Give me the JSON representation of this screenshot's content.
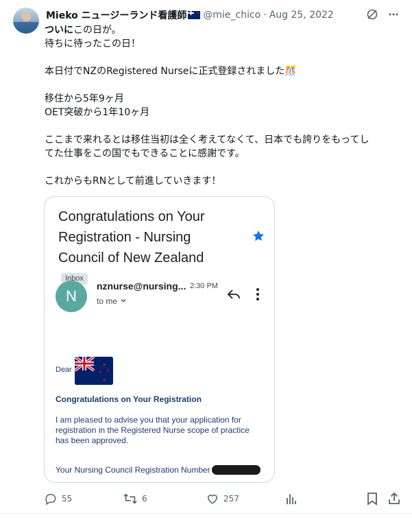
{
  "author": {
    "name": "Mieko ニュージーランド看護師",
    "handle": "@mie_chico",
    "separator": "·",
    "date": "Aug 25, 2022"
  },
  "tweet": {
    "line1_bold": "ついに",
    "line1_rest": "この日が。",
    "line2": "待ちに待ったこの日！",
    "line3": "本日付でNZのRegistered Nurseに正式登録されました🎊",
    "line4": "移住から5年9ヶ月",
    "line5": "OET突破から1年10ヶ月",
    "line6": "ここまで来れるとは移住当初は全く考えてなくて、日本でも誇りをもってし",
    "line7": "てた仕事をこの国でもできることに感謝です。",
    "line8": "これからもRNとして前進していきます！"
  },
  "email": {
    "subject": "Congratulations on Your Registration - Nursing Council of New Zealand",
    "label": "Inbox",
    "sender_initial": "N",
    "sender": "nznurse@nursing...",
    "time": "2:30 PM",
    "to": "to me",
    "greeting": "Dear",
    "heading": "Congratulations on Your Registration",
    "body": "I am pleased to advise you that your application for registration in the Registered Nurse scope of practice has been approved.",
    "reg_label": "Your Nursing Council Registration Number"
  },
  "actions": {
    "replies": "55",
    "retweets": "6",
    "likes": "257"
  },
  "colors": {
    "accent_star": "#1a73e8",
    "sender_avatar": "#59a9a1",
    "email_text": "#1f3c6e"
  },
  "icons": [
    "grok-icon",
    "more-icon",
    "star-icon",
    "reply-arrow-icon",
    "vertical-dots-icon",
    "reply-icon",
    "retweet-icon",
    "like-icon",
    "views-icon",
    "bookmark-icon",
    "share-icon"
  ]
}
